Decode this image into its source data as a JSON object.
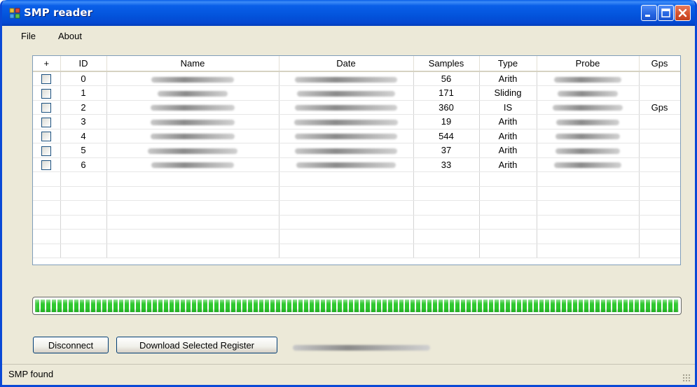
{
  "window": {
    "title": "SMP reader"
  },
  "menu": {
    "items": [
      {
        "label": "File"
      },
      {
        "label": "About"
      }
    ]
  },
  "grid": {
    "columns": [
      {
        "key": "sel",
        "label": "+"
      },
      {
        "key": "id",
        "label": "ID"
      },
      {
        "key": "name",
        "label": "Name"
      },
      {
        "key": "date",
        "label": "Date"
      },
      {
        "key": "samples",
        "label": "Samples"
      },
      {
        "key": "type",
        "label": "Type"
      },
      {
        "key": "probe",
        "label": "Probe"
      },
      {
        "key": "gps",
        "label": "Gps"
      }
    ],
    "rows": [
      {
        "id": "0",
        "samples": "56",
        "type": "Arith",
        "gps": ""
      },
      {
        "id": "1",
        "samples": "171",
        "type": "Sliding",
        "gps": ""
      },
      {
        "id": "2",
        "samples": "360",
        "type": "IS",
        "gps": "Gps"
      },
      {
        "id": "3",
        "samples": "19",
        "type": "Arith",
        "gps": ""
      },
      {
        "id": "4",
        "samples": "544",
        "type": "Arith",
        "gps": ""
      },
      {
        "id": "5",
        "samples": "37",
        "type": "Arith",
        "gps": ""
      },
      {
        "id": "6",
        "samples": "33",
        "type": "Arith",
        "gps": ""
      }
    ],
    "empty_rows": 6
  },
  "progress": {
    "fraction": 1.0,
    "color": "#2ec82e"
  },
  "buttons": {
    "disconnect": "Disconnect",
    "download": "Download Selected Register"
  },
  "status": {
    "text": "SMP found"
  },
  "colors": {
    "titlebar": "#0a5fe8",
    "window_bg": "#ece9d8",
    "close_button": "#d4502c"
  },
  "icons": {
    "app": "app-window-icon",
    "minimize": "minimize-icon",
    "maximize": "maximize-icon",
    "close": "close-icon",
    "grip": "resize-grip-icon"
  }
}
